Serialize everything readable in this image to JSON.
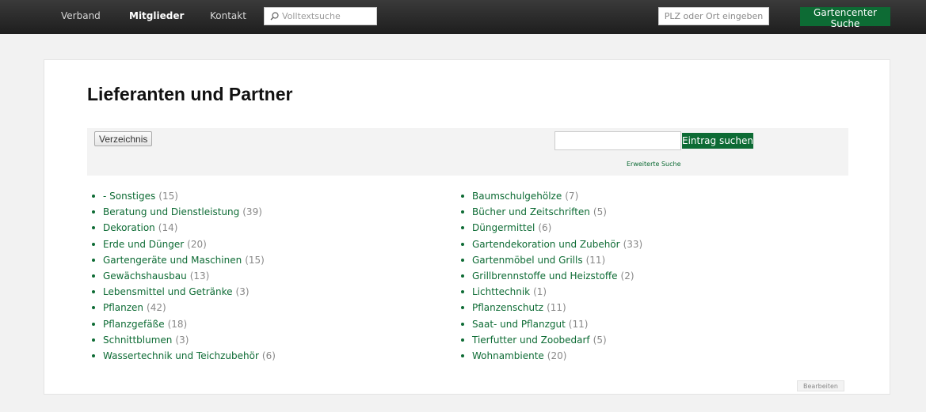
{
  "nav": {
    "items": [
      {
        "label": "Verband",
        "active": false
      },
      {
        "label": "Mitglieder",
        "active": true
      },
      {
        "label": "Kontakt",
        "active": false
      }
    ],
    "fulltext_placeholder": "Volltextsuche",
    "plz_placeholder": "PLZ oder Ort eingeben",
    "gartencenter_button": "Gartencenter Suche"
  },
  "main": {
    "title": "Lieferanten und Partner",
    "directory_button": "Verzeichnis",
    "search_button": "Eintrag suchen",
    "advanced_search": "Erweiterte Suche",
    "edit_button": "Bearbeiten",
    "categories_left": [
      {
        "name": "- Sonstiges",
        "count": "(15)"
      },
      {
        "name": "Beratung und Dienstleistung",
        "count": "(39)"
      },
      {
        "name": "Dekoration",
        "count": "(14)"
      },
      {
        "name": "Erde und Dünger",
        "count": "(20)"
      },
      {
        "name": "Gartengeräte und Maschinen",
        "count": "(15)"
      },
      {
        "name": "Gewächshausbau",
        "count": "(13)"
      },
      {
        "name": "Lebensmittel und Getränke",
        "count": "(3)"
      },
      {
        "name": "Pflanzen",
        "count": "(42)"
      },
      {
        "name": "Pflanzgefäße",
        "count": "(18)"
      },
      {
        "name": "Schnittblumen",
        "count": "(3)"
      },
      {
        "name": "Wassertechnik und Teichzubehör",
        "count": "(6)"
      }
    ],
    "categories_right": [
      {
        "name": "Baumschulgehölze",
        "count": "(7)"
      },
      {
        "name": "Bücher und Zeitschriften",
        "count": "(5)"
      },
      {
        "name": "Düngermittel",
        "count": "(6)"
      },
      {
        "name": "Gartendekoration und Zubehör",
        "count": "(33)"
      },
      {
        "name": "Gartenmöbel und Grills",
        "count": "(11)"
      },
      {
        "name": "Grillbrennstoffe und Heizstoffe",
        "count": "(2)"
      },
      {
        "name": "Lichttechnik",
        "count": "(1)"
      },
      {
        "name": "Pflanzenschutz",
        "count": "(11)"
      },
      {
        "name": "Saat- und Pflanzgut",
        "count": "(11)"
      },
      {
        "name": "Tierfutter und Zoobedarf",
        "count": "(5)"
      },
      {
        "name": "Wohnambiente",
        "count": "(20)"
      }
    ]
  },
  "colors": {
    "brand_green": "#0d6b34",
    "topbar": "#2a2a2a"
  },
  "icons": {
    "fulltext_search": "search-icon"
  }
}
